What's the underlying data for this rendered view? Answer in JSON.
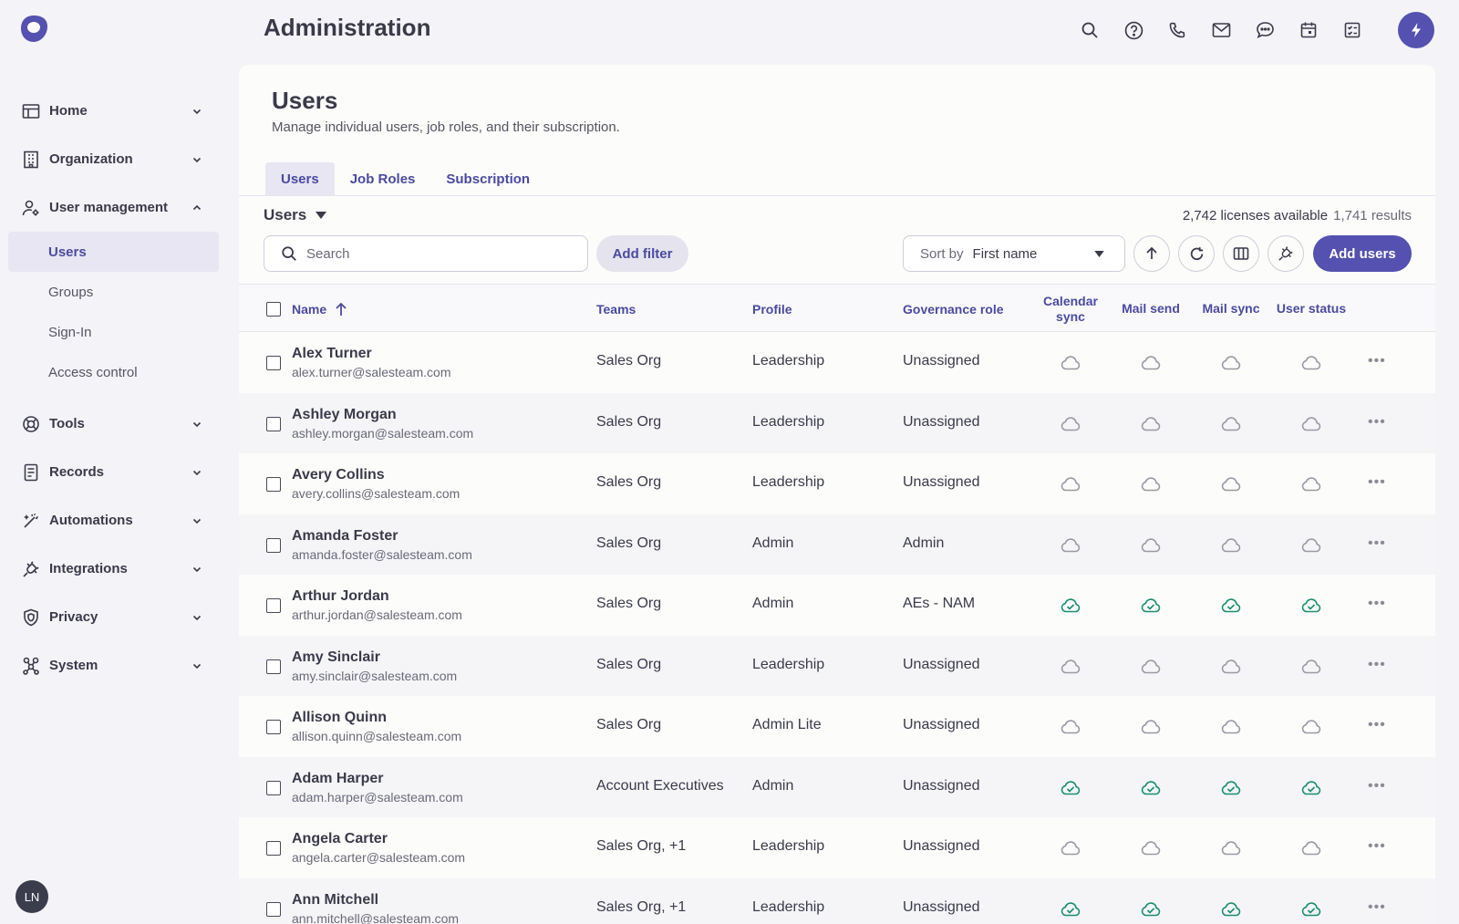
{
  "colors": {
    "accent": "#5451b0",
    "sync_on": "#1a8f6e",
    "sync_off": "#9a9aa6"
  },
  "header": {
    "title": "Administration",
    "icons": [
      "search-icon",
      "help-icon",
      "phone-icon",
      "mail-icon",
      "chat-icon",
      "calendar-icon",
      "tasks-icon"
    ],
    "action_icon": "bolt-icon"
  },
  "sidebar": {
    "items": [
      {
        "label": "Home",
        "icon": "home-icon"
      },
      {
        "label": "Organization",
        "icon": "building-icon"
      },
      {
        "label": "User management",
        "icon": "user-gear-icon",
        "expanded": true,
        "children": [
          {
            "label": "Users",
            "active": true
          },
          {
            "label": "Groups"
          },
          {
            "label": "Sign-In"
          },
          {
            "label": "Access control"
          }
        ]
      },
      {
        "label": "Tools",
        "icon": "tools-icon"
      },
      {
        "label": "Records",
        "icon": "records-icon"
      },
      {
        "label": "Automations",
        "icon": "automations-icon"
      },
      {
        "label": "Integrations",
        "icon": "plug-icon"
      },
      {
        "label": "Privacy",
        "icon": "shield-icon"
      },
      {
        "label": "System",
        "icon": "system-icon"
      }
    ],
    "avatar_initials": "LN"
  },
  "page": {
    "title": "Users",
    "description": "Manage individual users, job roles, and their subscription."
  },
  "tabs": [
    {
      "label": "Users",
      "active": true
    },
    {
      "label": "Job Roles"
    },
    {
      "label": "Subscription"
    }
  ],
  "toolbar": {
    "view_label": "Users",
    "licenses": "2,742 licenses available",
    "results": "1,741 results",
    "search_placeholder": "Search",
    "add_filter": "Add filter",
    "sort_label": "Sort by",
    "sort_value": "First name",
    "add_users": "Add users"
  },
  "table": {
    "headers": {
      "name": "Name",
      "teams": "Teams",
      "profile": "Profile",
      "governance": "Governance role",
      "calendar_sync": "Calendar sync",
      "mail_send": "Mail send",
      "mail_sync": "Mail sync",
      "user_status": "User status"
    },
    "rows": [
      {
        "name": "Alex Turner",
        "email": "alex.turner@salesteam.com",
        "teams": "Sales Org",
        "profile": "Leadership",
        "governance": "Unassigned",
        "synced": false
      },
      {
        "name": "Ashley Morgan",
        "email": "ashley.morgan@salesteam.com",
        "teams": "Sales Org",
        "profile": "Leadership",
        "governance": "Unassigned",
        "synced": false
      },
      {
        "name": "Avery Collins",
        "email": "avery.collins@salesteam.com",
        "teams": "Sales Org",
        "profile": "Leadership",
        "governance": "Unassigned",
        "synced": false
      },
      {
        "name": "Amanda Foster",
        "email": "amanda.foster@salesteam.com",
        "teams": "Sales Org",
        "profile": "Admin",
        "governance": "Admin",
        "synced": false
      },
      {
        "name": "Arthur Jordan",
        "email": "arthur.jordan@salesteam.com",
        "teams": "Sales Org",
        "profile": "Admin",
        "governance": "AEs - NAM",
        "synced": true
      },
      {
        "name": "Amy Sinclair",
        "email": "amy.sinclair@salesteam.com",
        "teams": "Sales Org",
        "profile": "Leadership",
        "governance": "Unassigned",
        "synced": false
      },
      {
        "name": "Allison Quinn",
        "email": "allison.quinn@salesteam.com",
        "teams": "Sales Org",
        "profile": "Admin Lite",
        "governance": "Unassigned",
        "synced": false
      },
      {
        "name": "Adam Harper",
        "email": "adam.harper@salesteam.com",
        "teams": "Account Executives",
        "profile": "Admin",
        "governance": "Unassigned",
        "synced": true
      },
      {
        "name": "Angela Carter",
        "email": "angela.carter@salesteam.com",
        "teams": "Sales Org, +1",
        "profile": "Leadership",
        "governance": "Unassigned",
        "synced": false
      },
      {
        "name": "Ann Mitchell",
        "email": "ann.mitchell@salesteam.com",
        "teams": "Sales Org, +1",
        "profile": "Leadership",
        "governance": "Unassigned",
        "synced": true
      }
    ]
  }
}
